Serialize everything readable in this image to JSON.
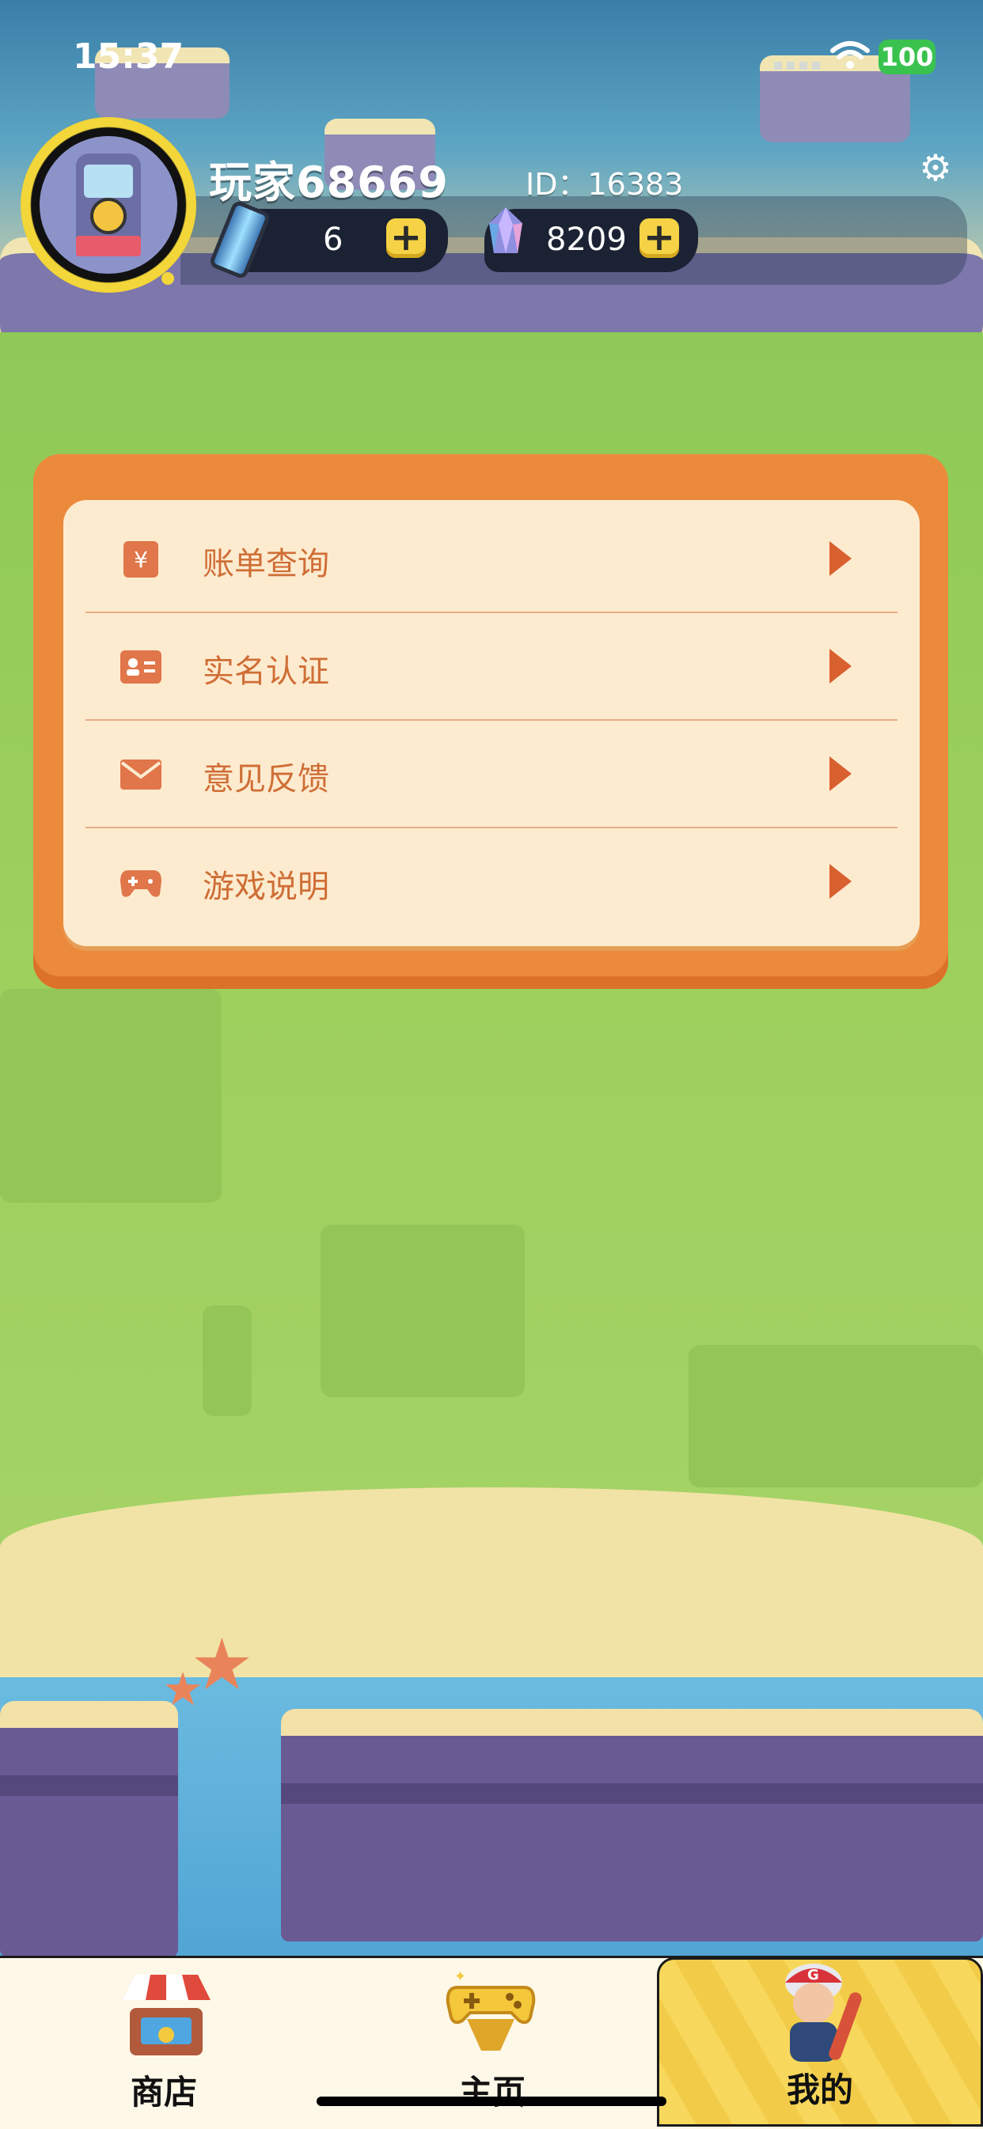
{
  "status_bar": {
    "time": "15:37",
    "battery": "100"
  },
  "profile": {
    "name": "玩家68669",
    "id_text": "ID：16383",
    "energy": "6",
    "gems": "8209"
  },
  "menu": {
    "items": [
      {
        "label": "账单查询",
        "icon": "bill-icon"
      },
      {
        "label": "实名认证",
        "icon": "id-card-icon"
      },
      {
        "label": "意见反馈",
        "icon": "mail-icon"
      },
      {
        "label": "游戏说明",
        "icon": "gamepad-icon"
      }
    ]
  },
  "tabs": [
    {
      "label": "商店",
      "icon": "shop-icon"
    },
    {
      "label": "主页",
      "icon": "gamepad-trophy-icon"
    },
    {
      "label": "我的",
      "icon": "player-icon",
      "active": true
    }
  ],
  "colors": {
    "accent_orange": "#ec8a3b",
    "menu_text": "#cf6e36",
    "active_tab": "#f7d85c",
    "battery_green": "#3ac24f"
  }
}
